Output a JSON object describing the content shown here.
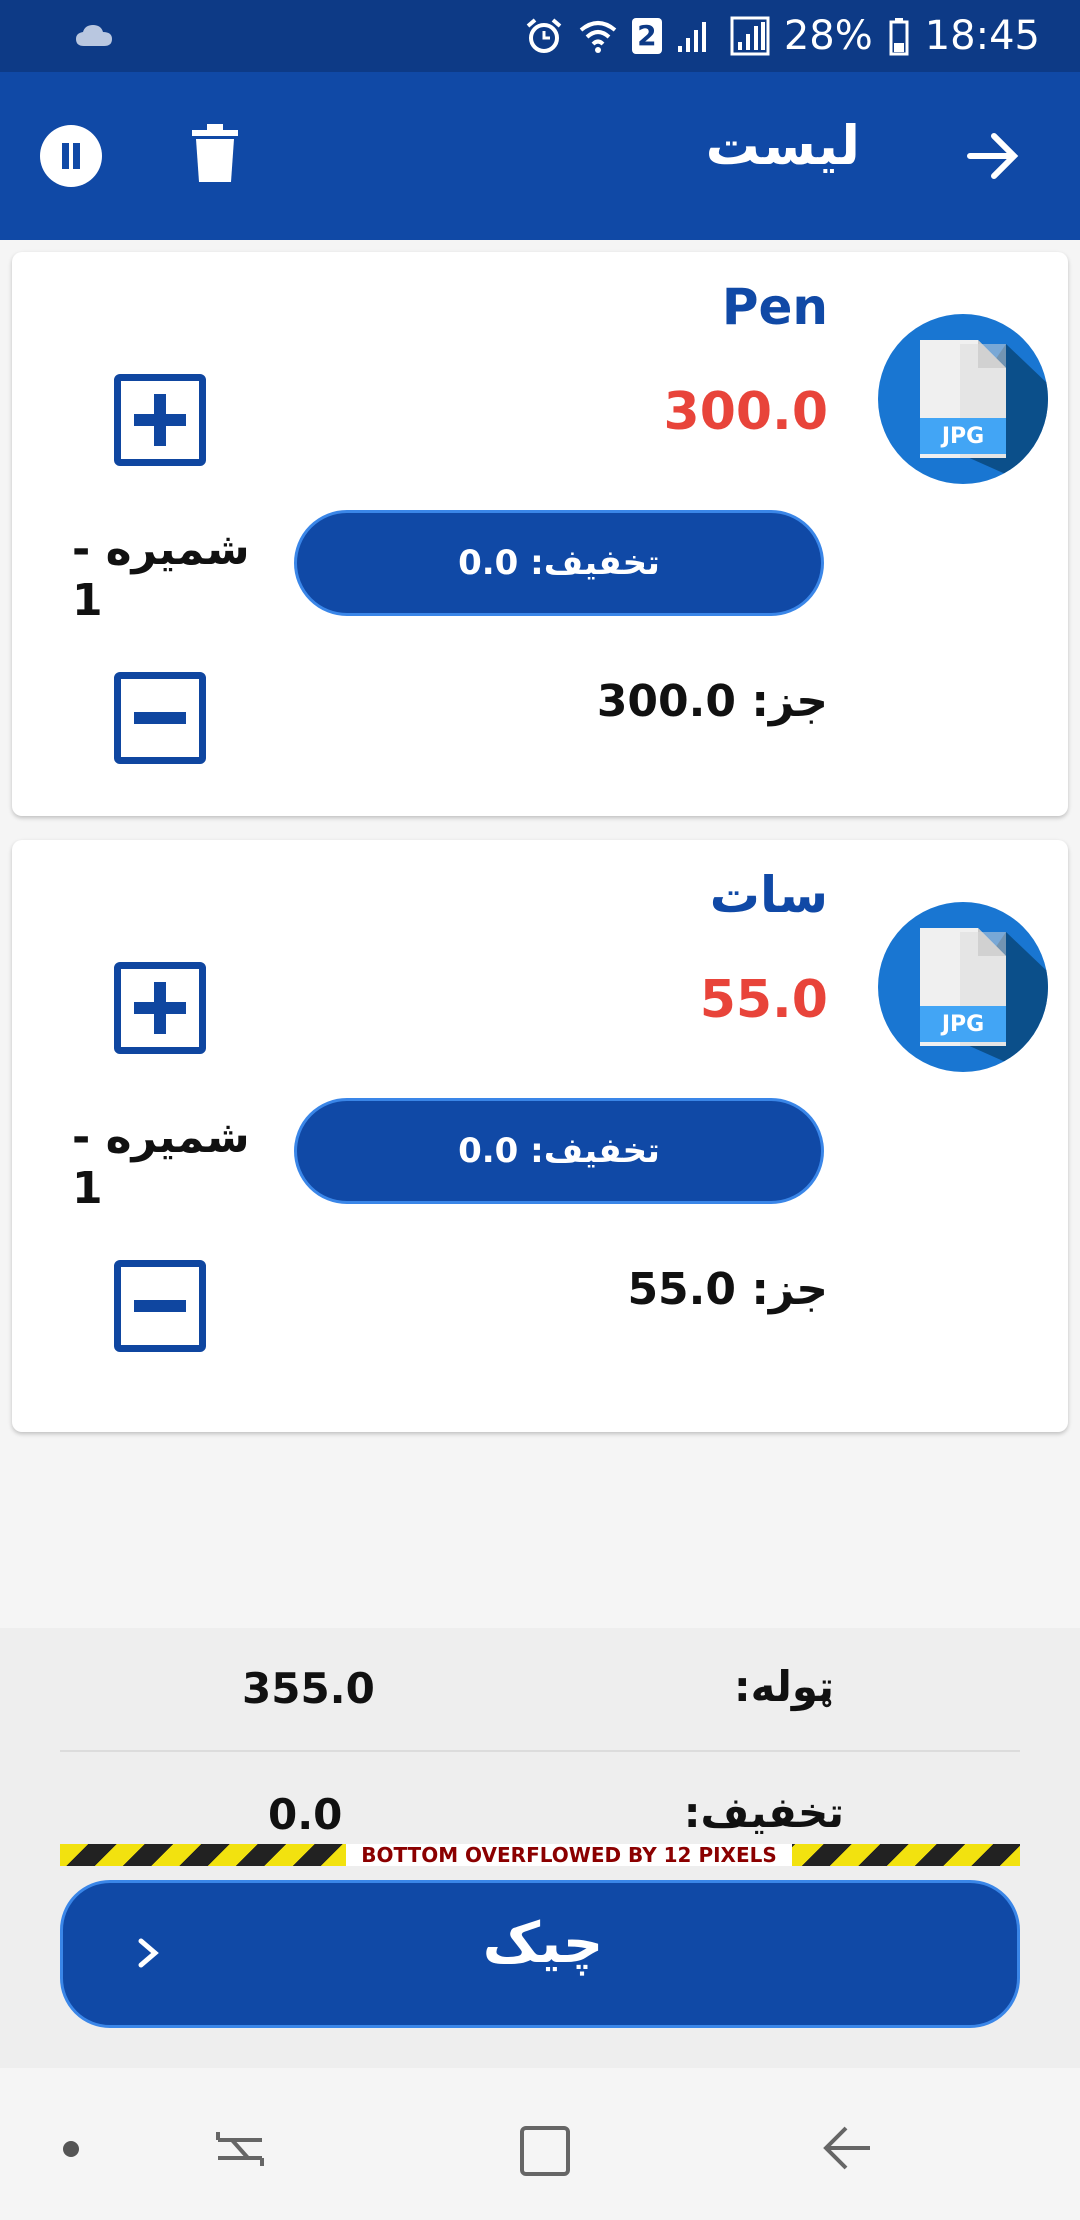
{
  "status_bar": {
    "battery": "28%",
    "time": "18:45",
    "notif_count": "2"
  },
  "app_bar": {
    "title": "لیست"
  },
  "items": [
    {
      "name": "Pen",
      "price": "300.0",
      "discount": "تخفیف: 0.0",
      "quantity": "شمیره - 1",
      "subtotal": "جز: 300.0",
      "thumb": "JPG"
    },
    {
      "name": "سات",
      "price": "55.0",
      "discount": "تخفیف: 0.0",
      "quantity": "شمیره - 1",
      "subtotal": "جز: 55.0",
      "thumb": "JPG"
    }
  ],
  "summary": {
    "total_label": "ټوله:",
    "total_value": "355.0",
    "discount_label": "تخفیف:",
    "discount_value": "0.0",
    "overflow_warning": "BOTTOM OVERFLOWED BY 12 PIXELS",
    "checkout_label": "چیک"
  },
  "colors": {
    "primary": "#1049a6",
    "status_bar": "#0d3a86",
    "price": "#e8443a"
  },
  "icons": [
    "cloud-icon",
    "alarm-icon",
    "wifi-icon",
    "signal-icon",
    "battery-icon",
    "pause-icon",
    "trash-icon",
    "arrow-forward-icon",
    "jpg-file-icon",
    "plus-icon",
    "minus-icon",
    "chevron-right-icon"
  ]
}
